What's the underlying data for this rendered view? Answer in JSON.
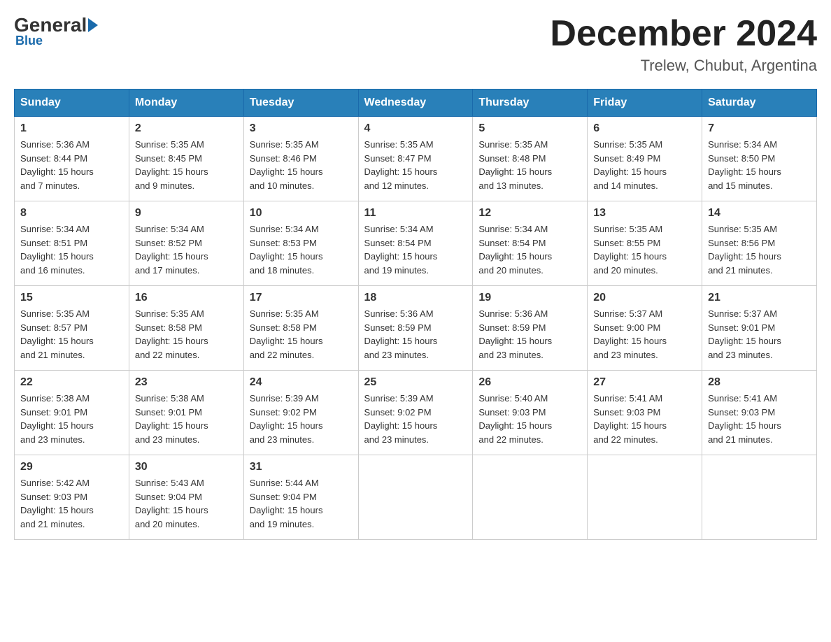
{
  "header": {
    "logo": {
      "general": "General",
      "blue": "Blue"
    },
    "month_title": "December 2024",
    "location": "Trelew, Chubut, Argentina"
  },
  "days_of_week": [
    "Sunday",
    "Monday",
    "Tuesday",
    "Wednesday",
    "Thursday",
    "Friday",
    "Saturday"
  ],
  "weeks": [
    [
      {
        "day": "1",
        "sunrise": "5:36 AM",
        "sunset": "8:44 PM",
        "daylight": "15 hours and 7 minutes."
      },
      {
        "day": "2",
        "sunrise": "5:35 AM",
        "sunset": "8:45 PM",
        "daylight": "15 hours and 9 minutes."
      },
      {
        "day": "3",
        "sunrise": "5:35 AM",
        "sunset": "8:46 PM",
        "daylight": "15 hours and 10 minutes."
      },
      {
        "day": "4",
        "sunrise": "5:35 AM",
        "sunset": "8:47 PM",
        "daylight": "15 hours and 12 minutes."
      },
      {
        "day": "5",
        "sunrise": "5:35 AM",
        "sunset": "8:48 PM",
        "daylight": "15 hours and 13 minutes."
      },
      {
        "day": "6",
        "sunrise": "5:35 AM",
        "sunset": "8:49 PM",
        "daylight": "15 hours and 14 minutes."
      },
      {
        "day": "7",
        "sunrise": "5:34 AM",
        "sunset": "8:50 PM",
        "daylight": "15 hours and 15 minutes."
      }
    ],
    [
      {
        "day": "8",
        "sunrise": "5:34 AM",
        "sunset": "8:51 PM",
        "daylight": "15 hours and 16 minutes."
      },
      {
        "day": "9",
        "sunrise": "5:34 AM",
        "sunset": "8:52 PM",
        "daylight": "15 hours and 17 minutes."
      },
      {
        "day": "10",
        "sunrise": "5:34 AM",
        "sunset": "8:53 PM",
        "daylight": "15 hours and 18 minutes."
      },
      {
        "day": "11",
        "sunrise": "5:34 AM",
        "sunset": "8:54 PM",
        "daylight": "15 hours and 19 minutes."
      },
      {
        "day": "12",
        "sunrise": "5:34 AM",
        "sunset": "8:54 PM",
        "daylight": "15 hours and 20 minutes."
      },
      {
        "day": "13",
        "sunrise": "5:35 AM",
        "sunset": "8:55 PM",
        "daylight": "15 hours and 20 minutes."
      },
      {
        "day": "14",
        "sunrise": "5:35 AM",
        "sunset": "8:56 PM",
        "daylight": "15 hours and 21 minutes."
      }
    ],
    [
      {
        "day": "15",
        "sunrise": "5:35 AM",
        "sunset": "8:57 PM",
        "daylight": "15 hours and 21 minutes."
      },
      {
        "day": "16",
        "sunrise": "5:35 AM",
        "sunset": "8:58 PM",
        "daylight": "15 hours and 22 minutes."
      },
      {
        "day": "17",
        "sunrise": "5:35 AM",
        "sunset": "8:58 PM",
        "daylight": "15 hours and 22 minutes."
      },
      {
        "day": "18",
        "sunrise": "5:36 AM",
        "sunset": "8:59 PM",
        "daylight": "15 hours and 23 minutes."
      },
      {
        "day": "19",
        "sunrise": "5:36 AM",
        "sunset": "8:59 PM",
        "daylight": "15 hours and 23 minutes."
      },
      {
        "day": "20",
        "sunrise": "5:37 AM",
        "sunset": "9:00 PM",
        "daylight": "15 hours and 23 minutes."
      },
      {
        "day": "21",
        "sunrise": "5:37 AM",
        "sunset": "9:01 PM",
        "daylight": "15 hours and 23 minutes."
      }
    ],
    [
      {
        "day": "22",
        "sunrise": "5:38 AM",
        "sunset": "9:01 PM",
        "daylight": "15 hours and 23 minutes."
      },
      {
        "day": "23",
        "sunrise": "5:38 AM",
        "sunset": "9:01 PM",
        "daylight": "15 hours and 23 minutes."
      },
      {
        "day": "24",
        "sunrise": "5:39 AM",
        "sunset": "9:02 PM",
        "daylight": "15 hours and 23 minutes."
      },
      {
        "day": "25",
        "sunrise": "5:39 AM",
        "sunset": "9:02 PM",
        "daylight": "15 hours and 23 minutes."
      },
      {
        "day": "26",
        "sunrise": "5:40 AM",
        "sunset": "9:03 PM",
        "daylight": "15 hours and 22 minutes."
      },
      {
        "day": "27",
        "sunrise": "5:41 AM",
        "sunset": "9:03 PM",
        "daylight": "15 hours and 22 minutes."
      },
      {
        "day": "28",
        "sunrise": "5:41 AM",
        "sunset": "9:03 PM",
        "daylight": "15 hours and 21 minutes."
      }
    ],
    [
      {
        "day": "29",
        "sunrise": "5:42 AM",
        "sunset": "9:03 PM",
        "daylight": "15 hours and 21 minutes."
      },
      {
        "day": "30",
        "sunrise": "5:43 AM",
        "sunset": "9:04 PM",
        "daylight": "15 hours and 20 minutes."
      },
      {
        "day": "31",
        "sunrise": "5:44 AM",
        "sunset": "9:04 PM",
        "daylight": "15 hours and 19 minutes."
      },
      null,
      null,
      null,
      null
    ]
  ]
}
